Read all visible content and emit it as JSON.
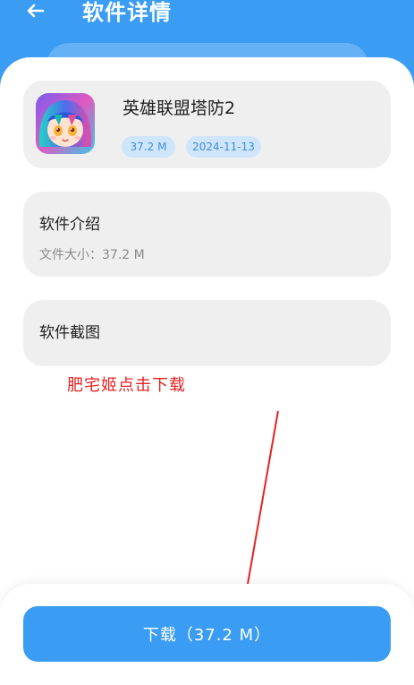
{
  "header": {
    "title": "软件详情",
    "back_icon": "back-arrow-icon"
  },
  "app": {
    "name": "英雄联盟塔防2",
    "size": "37.2 M",
    "date": "2024-11-13",
    "icon": "app-avatar-icon"
  },
  "intro": {
    "title": "软件介绍",
    "file_size_label": "文件大小：37.2 M"
  },
  "screenshots": {
    "title": "软件截图"
  },
  "annotation": {
    "text": "肥宅姬点击下载"
  },
  "download": {
    "label": "下载（37.2 M）"
  },
  "colors": {
    "primary": "#3a9cf2",
    "card": "#efefef",
    "tag_bg": "#cfe5fb",
    "tag_text": "#3d8fe4",
    "annotation": "#e62121"
  }
}
